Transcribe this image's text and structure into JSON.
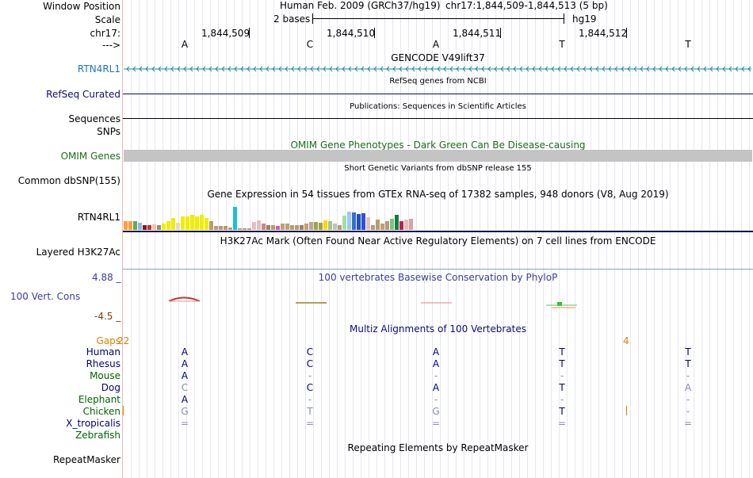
{
  "header": {
    "window_position_label": "Window Position",
    "scale_label": "Scale",
    "chrom_label": "chr17:",
    "strand_label": "--->",
    "assembly": "Human Feb. 2009 (GRCh37/hg19)",
    "position": "chr17:1,844,509-1,844,513 (5 bp)",
    "scale_text": "2 bases",
    "db": "hg19",
    "ruler_positions": [
      "1,844,509",
      "1,844,510",
      "1,844,511",
      "1,844,512"
    ],
    "bases": [
      "A",
      "C",
      "A",
      "T",
      "T"
    ]
  },
  "tracks": {
    "gencode_title": "GENCODE V49lift37",
    "gencode_gene": "RTN4RL1",
    "refseq_title": "RefSeq genes from NCBI",
    "refseq_label": "RefSeq Curated",
    "publications_title": "Publications: Sequences in Scientific Articles",
    "sequences_label": "Sequences",
    "snps_label": "SNPs",
    "omim_title": "OMIM Gene Phenotypes - Dark Green Can Be Disease-causing",
    "omim_label": "OMIM Genes",
    "dbsnp_title": "Short Genetic Variants from dbSNP release 155",
    "dbsnp_label": "Common dbSNP(155)",
    "gtex_title": "Gene Expression in 54 tissues from GTEx RNA-seq of 17382 samples, 948 donors (V8, Aug 2019)",
    "gtex_label": "RTN4RL1",
    "h3k27_title": "H3K27Ac Mark (Often Found Near Active Regulatory Elements) on 7 cell lines from ENCODE",
    "h3k27_label": "Layered H3K27Ac",
    "cons_title": "100 vertebrates Basewise Conservation by PhyloP",
    "cons_label": "100 Vert. Cons",
    "cons_max": "4.88 _",
    "cons_min": "-4.5 _",
    "multiz_title": "Multiz Alignments of 100 Vertebrates",
    "gaps_label": "Gaps",
    "gap_left": "22",
    "gap_right": "4",
    "repeat_title": "Repeating Elements by RepeatMasker",
    "repeat_label": "RepeatMasker"
  },
  "gtex_levels": [
    0.3,
    0.28,
    0.28,
    0.24,
    0.17,
    0.17,
    0.18,
    0.17,
    0.2,
    0.3,
    0.39,
    0.24,
    0.46,
    0.46,
    0.49,
    0.46,
    0.49,
    0.4,
    0.3,
    0.14,
    0.13,
    0.12,
    0.08,
    0.75,
    0.05,
    0.06,
    0.05,
    0.27,
    0.31,
    0.2,
    0.17,
    0.16,
    0.13,
    0.21,
    0.21,
    0.17,
    0.17,
    0.15,
    0.21,
    0.27,
    0.27,
    0.24,
    0.31,
    0.29,
    0.2,
    0.15,
    0.47,
    0.6,
    0.57,
    0.52,
    0.55,
    0.43,
    0.16,
    0.33,
    0.21,
    0.28,
    0.37,
    0.49,
    0.29,
    0.33,
    0.36
  ],
  "gtex_colors": [
    "#ff9f3b",
    "#ff9f3b",
    "#5fad56",
    "#9ab3d1",
    "#7a1c2c",
    "#b23a2e",
    "#f5c0a5",
    "#9e8a6c",
    "#eeee00",
    "#eeee00",
    "#eeee00",
    "#e6d8c6",
    "#eeee00",
    "#eeee00",
    "#eeee00",
    "#eeee00",
    "#eeee00",
    "#eeee00",
    "#b79a78",
    "#b79a78",
    "#b79a78",
    "#b79a78",
    "#b79a78",
    "#1ac0d6",
    "#b79a78",
    "#b79a78",
    "#b79a78",
    "#e0c0c0",
    "#e0c0c0",
    "#c58a8a",
    "#a08060",
    "#b79a78",
    "#c060c0",
    "#c0a070",
    "#c0a070",
    "#b79a78",
    "#b79a78",
    "#a08060",
    "#c0a070",
    "#b9a88c",
    "#a0a050",
    "#a0a050",
    "#ffd700",
    "#a9c48a",
    "#c0c0c0",
    "#b79a78",
    "#9fe0a0",
    "#a0c8f0",
    "#3070d0",
    "#2050c0",
    "#3050d0",
    "#e0c0c0",
    "#b79a78",
    "#b79a78",
    "#c0a070",
    "#b79a78",
    "#80c080",
    "#108040",
    "#c02050",
    "#e0c0c0",
    "#e0a0a0"
  ],
  "alignment": {
    "species": [
      {
        "name": "Human",
        "color": "#000080",
        "bases": [
          "A",
          "C",
          "A",
          "T",
          "T"
        ],
        "dim": [
          false,
          false,
          false,
          false,
          false
        ]
      },
      {
        "name": "Rhesus",
        "color": "#000080",
        "bases": [
          "A",
          "C",
          "A",
          "T",
          "T"
        ],
        "dim": [
          false,
          false,
          false,
          false,
          false
        ]
      },
      {
        "name": "Mouse",
        "color": "#006400",
        "bases": [
          "A",
          "-",
          "-",
          "-",
          "-"
        ],
        "dim": [
          false,
          true,
          true,
          true,
          true
        ]
      },
      {
        "name": "Dog",
        "color": "#000080",
        "bases": [
          "C",
          "C",
          "A",
          "T",
          "A"
        ],
        "dim": [
          true,
          false,
          false,
          false,
          true
        ]
      },
      {
        "name": "Elephant",
        "color": "#006400",
        "bases": [
          "A",
          "-",
          "-",
          "-",
          "-"
        ],
        "dim": [
          false,
          true,
          true,
          true,
          true
        ]
      },
      {
        "name": "Chicken",
        "color": "#006400",
        "bases": [
          "G",
          "T",
          "G",
          "T",
          "-"
        ],
        "dim": [
          true,
          true,
          true,
          false,
          true
        ]
      },
      {
        "name": "X_tropicalis",
        "color": "#000080",
        "bases": [
          "=",
          "=",
          "=",
          "=",
          "="
        ],
        "dim": [
          true,
          true,
          true,
          true,
          true
        ]
      },
      {
        "name": "Zebrafish",
        "color": "#006400",
        "bases": [
          "",
          "",
          "",
          "",
          ""
        ],
        "dim": [
          true,
          true,
          true,
          true,
          true
        ]
      }
    ]
  }
}
